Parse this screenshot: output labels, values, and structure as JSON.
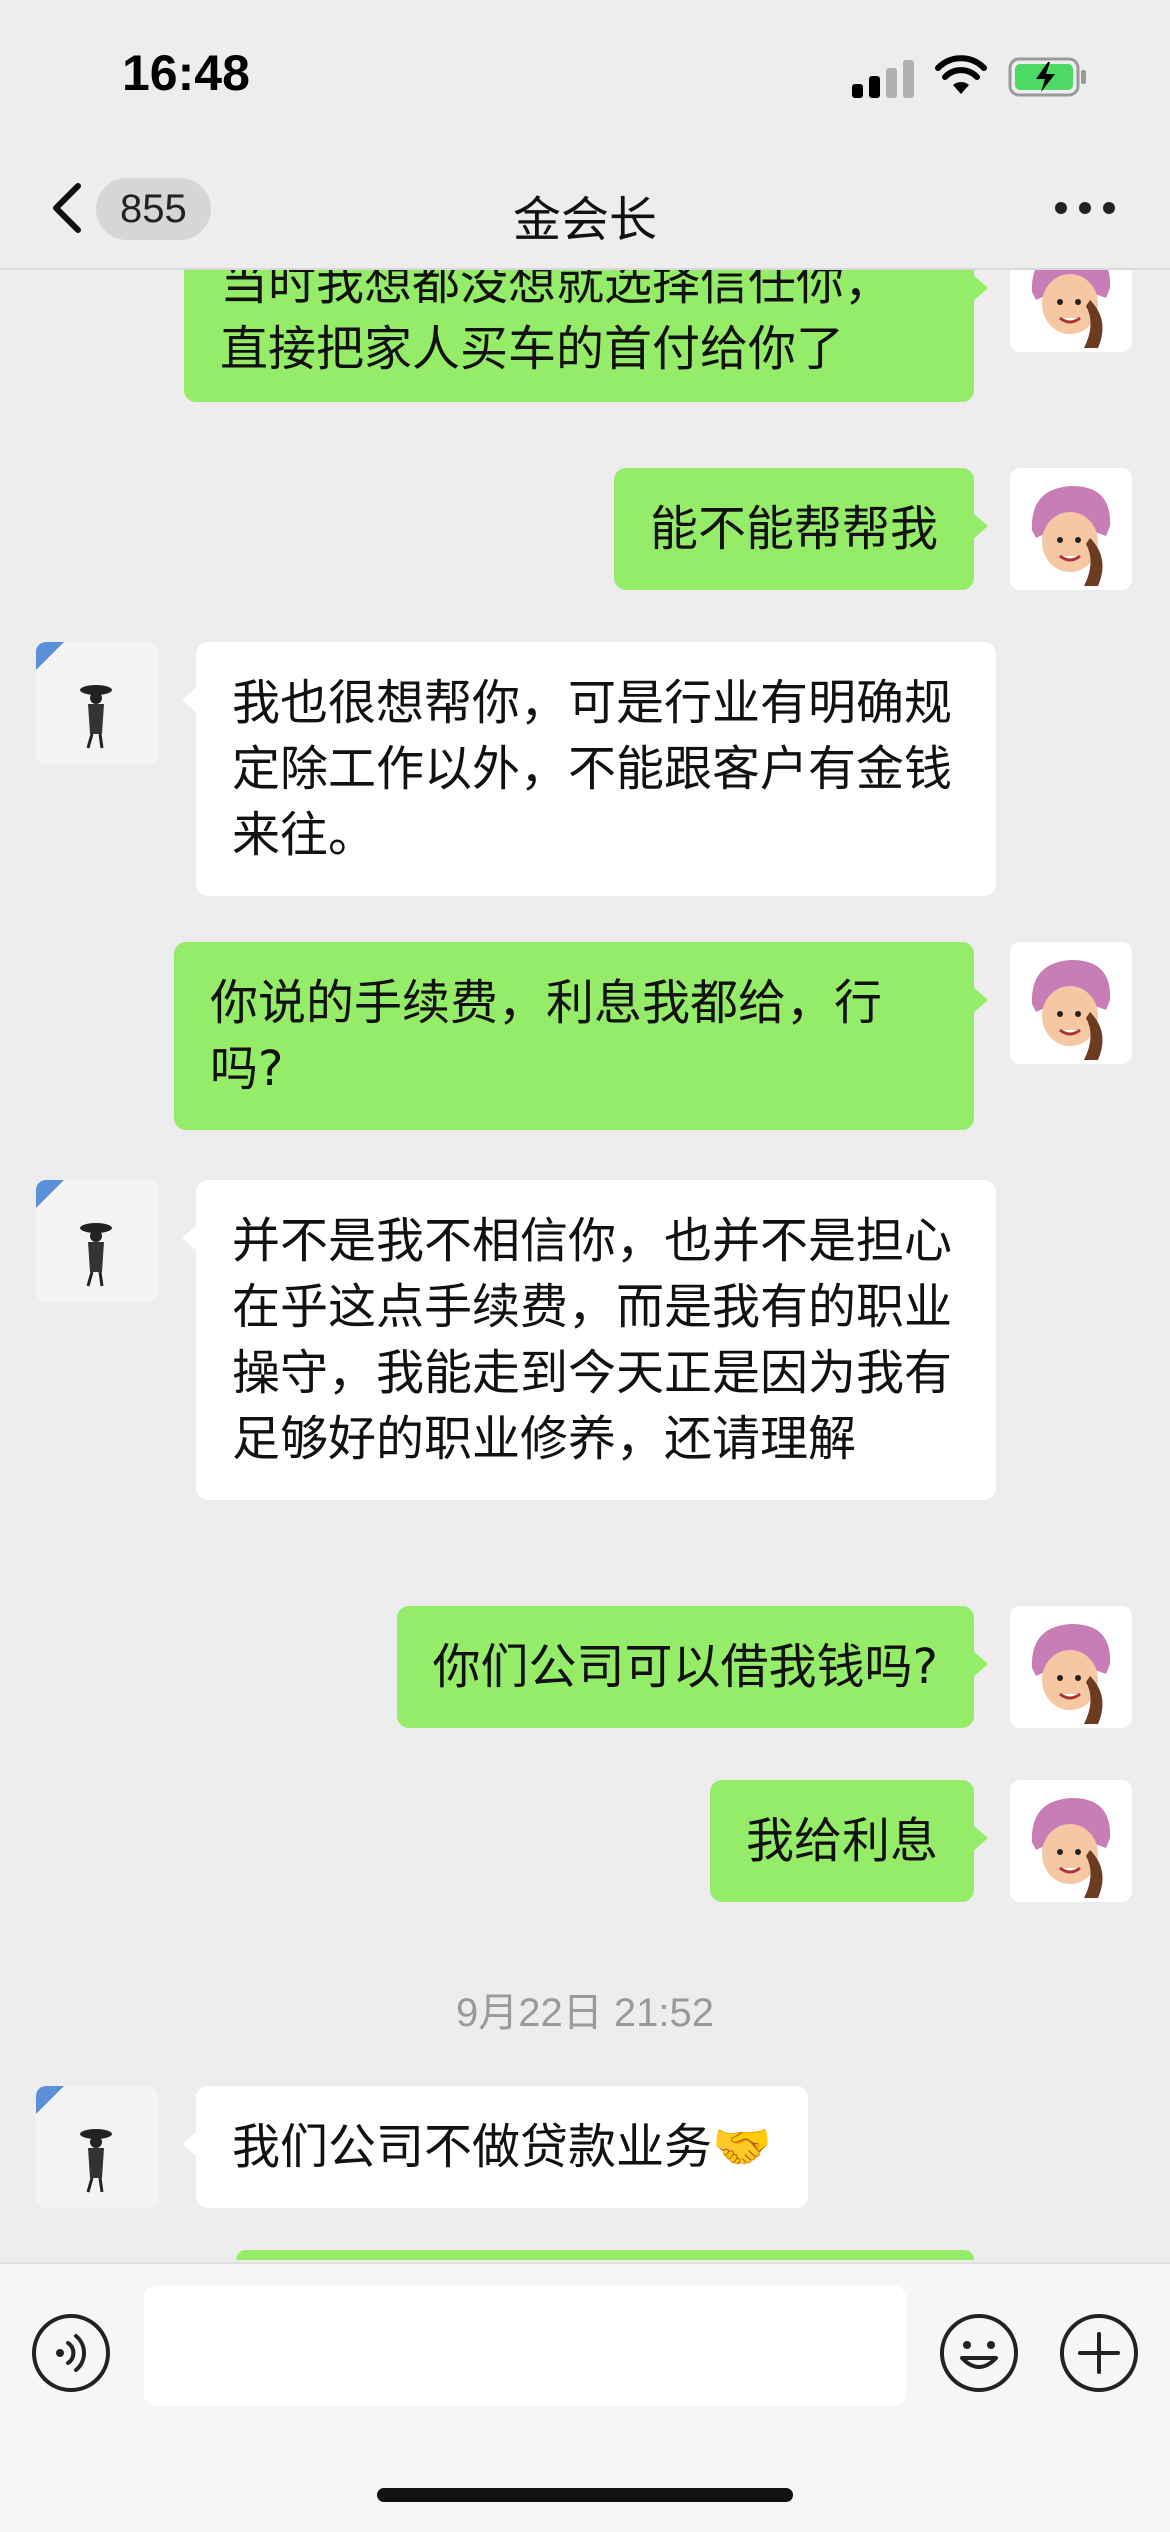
{
  "status_bar": {
    "time": "16:48"
  },
  "nav": {
    "back_count": "855",
    "title": "金会长"
  },
  "messages": [
    {
      "side": "right",
      "text": "当时我想都没想就选择信任你，直接把家人买车的首付给你了"
    },
    {
      "side": "right",
      "text": "能不能帮帮我"
    },
    {
      "side": "left",
      "text": "我也很想帮你，可是行业有明确规定除工作以外，不能跟客户有金钱来往。"
    },
    {
      "side": "right",
      "text": "你说的手续费，利息我都给，行吗?"
    },
    {
      "side": "left",
      "text": "并不是我不相信你，也并不是担心在乎这点手续费，而是我有的职业操守，我能走到今天正是因为我有足够好的职业修养，还请理解"
    },
    {
      "side": "right",
      "text": "你们公司可以借我钱吗?"
    },
    {
      "side": "right",
      "text": "我给利息"
    },
    {
      "side": "left",
      "text": "我们公司不做贷款业务🤝"
    }
  ],
  "timestamp": "9月22日 21:52",
  "input": {
    "value": ""
  },
  "colors": {
    "sent_bubble": "#95ec69",
    "received_bubble": "#ffffff",
    "background": "#ededed"
  }
}
